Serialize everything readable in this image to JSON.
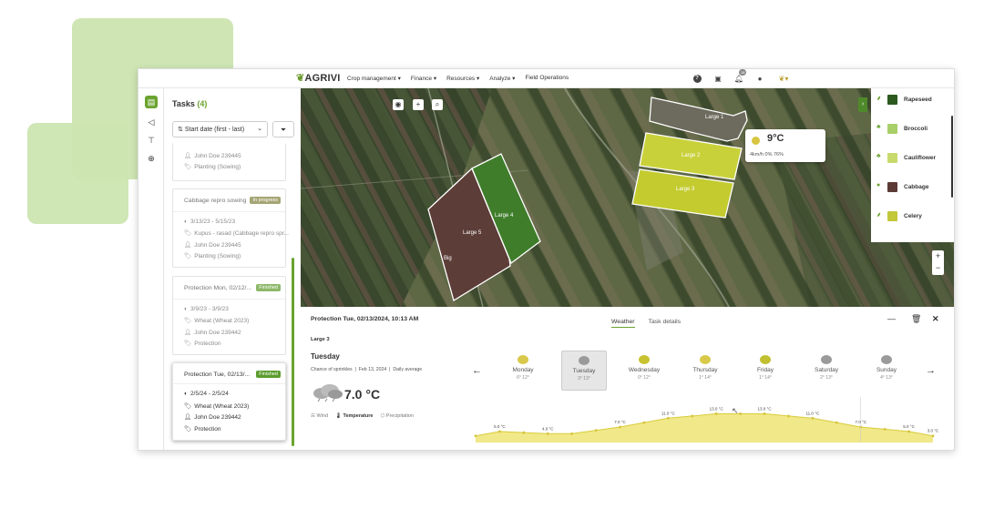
{
  "topbar": {
    "logo": "AGRIVI",
    "menu": [
      "Crop management ▾",
      "Finance ▾",
      "Resources ▾",
      "Analyze ▾",
      "Field Operations"
    ],
    "notification_count": "18",
    "icons": [
      "help-icon",
      "calendar-icon",
      "bell-icon",
      "chat-icon",
      "user-icon"
    ]
  },
  "rail": {
    "icons": [
      "clipboard-icon",
      "megaphone-icon",
      "scan-icon",
      "zoom-search-icon"
    ]
  },
  "tasks": {
    "title": "Tasks",
    "count": "(4)",
    "sort_label": "Start date (first - last)",
    "cards": [
      {
        "title": "",
        "status": "",
        "lines": [
          "John Doe 239445",
          "Planting (Sowing)"
        ]
      },
      {
        "title": "Cabbage repro sowing",
        "status": "In progress",
        "lines": [
          "3/13/23 - 5/15/23",
          "Kupus - rasad (Cabbage repro spr...",
          "John Doe 239445",
          "Planting (Sowing)"
        ]
      },
      {
        "title": "Protection Mon, 02/12/...",
        "status": "Finished",
        "lines": [
          "3/9/23 - 3/9/23",
          "Wheat (Wheat 2023)",
          "John Doe 239442",
          "Protection"
        ]
      },
      {
        "title": "Protection Tue, 02/13/...",
        "status": "Finished",
        "lines": [
          "2/5/24 - 2/5/24",
          "Wheat (Wheat 2023)",
          "John Doe 239442",
          "Protection"
        ]
      }
    ]
  },
  "map": {
    "fields": [
      "Large 1",
      "Large 2",
      "Large 3",
      "Large 4",
      "Large 5",
      "Big"
    ],
    "weather_tip": {
      "temp": "9°C",
      "details": "4km/h   0%   76%"
    },
    "legend": [
      {
        "name": "Rapeseed",
        "color": "#2c5a1e"
      },
      {
        "name": "Broccoli",
        "color": "#a9cf6a"
      },
      {
        "name": "Cauliflower",
        "color": "#c9da6c"
      },
      {
        "name": "Cabbage",
        "color": "#5c3a36"
      },
      {
        "name": "Celery",
        "color": "#c3c73a"
      }
    ]
  },
  "weather": {
    "title": "Protection Tue, 02/13/2024, 10:13 AM",
    "tabs": [
      "Weather",
      "Task details"
    ],
    "field": "Large 3",
    "day": "Tuesday",
    "condition": "Chance of sprinkles",
    "date": "Feb 13, 2024",
    "mode": "Daily average",
    "temperature": "7.0 °C",
    "toggles": [
      "Wind",
      "Temperature",
      "Precipitation"
    ],
    "days": [
      {
        "name": "Monday",
        "range": "6° 12°",
        "icon": "partly-sunny-icon",
        "color": "#d9c94a"
      },
      {
        "name": "Tuesday",
        "range": "3° 13°",
        "icon": "cloud-rain-icon",
        "color": "#9a9a9a"
      },
      {
        "name": "Wednesday",
        "range": "0° 12°",
        "icon": "sun-icon",
        "color": "#c8c230"
      },
      {
        "name": "Thursday",
        "range": "1° 14°",
        "icon": "partly-sunny-icon",
        "color": "#d9c94a"
      },
      {
        "name": "Friday",
        "range": "1° 14°",
        "icon": "sun-icon",
        "color": "#c0c030"
      },
      {
        "name": "Saturday",
        "range": "2° 13°",
        "icon": "cloud-icon",
        "color": "#9a9a9a"
      },
      {
        "name": "Sunday",
        "range": "4° 13°",
        "icon": "cloud-icon",
        "color": "#9a9a9a"
      }
    ]
  },
  "chart_data": {
    "type": "area",
    "title": "",
    "xlabel": "",
    "ylabel": "",
    "x": [
      0,
      1,
      2,
      3,
      4,
      5,
      6,
      7,
      8,
      9,
      10,
      11,
      12,
      13,
      14,
      15,
      16,
      17,
      18,
      19
    ],
    "values": [
      3.0,
      5.0,
      4.5,
      4.0,
      4.0,
      5.5,
      7.0,
      9.0,
      11.0,
      12.0,
      13.0,
      13.0,
      13.0,
      12.0,
      11.0,
      9.0,
      7.0,
      6.0,
      5.0,
      3.0
    ],
    "labels": [
      {
        "i": 1,
        "text": "5.0 °C"
      },
      {
        "i": 3,
        "text": "4.0 °C"
      },
      {
        "i": 6,
        "text": "7.0 °C"
      },
      {
        "i": 8,
        "text": "11.0 °C"
      },
      {
        "i": 10,
        "text": "13.0 °C"
      },
      {
        "i": 12,
        "text": "13.0 °C"
      },
      {
        "i": 14,
        "text": "11.0 °C"
      },
      {
        "i": 16,
        "text": "7.0 °C"
      },
      {
        "i": 18,
        "text": "5.0 °C"
      },
      {
        "i": 19,
        "text": "3.0 °C"
      }
    ],
    "color": "#f1e889",
    "line_color": "#d9cc3c"
  }
}
